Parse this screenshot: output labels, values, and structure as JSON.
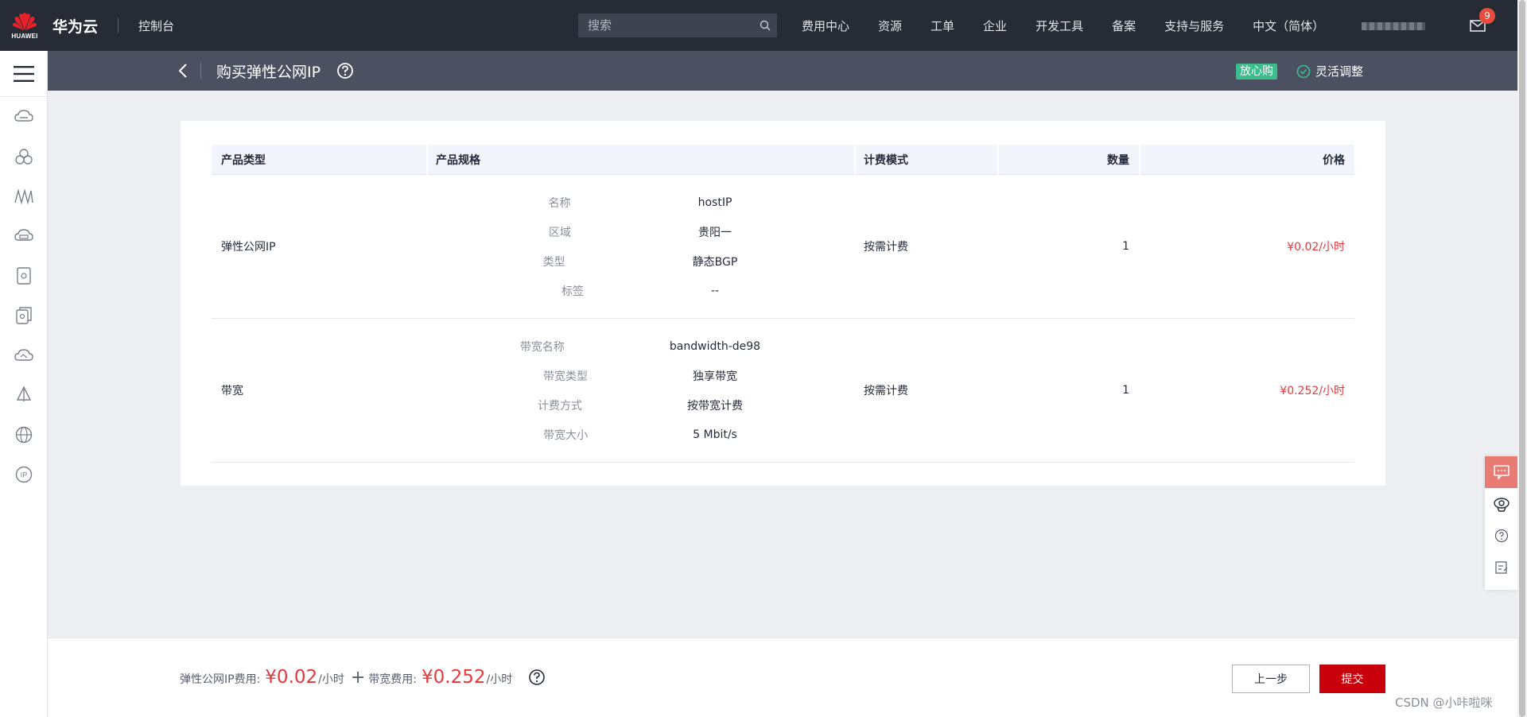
{
  "header": {
    "logo_text": "HUAWEI",
    "brand": "华为云",
    "console": "控制台",
    "search_placeholder": "搜索",
    "nav": [
      "费用中心",
      "资源",
      "工单",
      "企业",
      "开发工具",
      "备案",
      "支持与服务",
      "中文（简体）"
    ],
    "mail_badge": "9"
  },
  "rail": {
    "icons": [
      "cloud-server-icon",
      "cluster-icon",
      "network-icon",
      "storage-icon",
      "database-icon",
      "backup-icon",
      "cloud-icon",
      "cdn-icon",
      "globe-icon",
      "ip-icon"
    ]
  },
  "subheader": {
    "title": "购买弹性公网IP",
    "reassure_label": "放心购",
    "flex_label": "灵活调整"
  },
  "table": {
    "headers": [
      "产品类型",
      "产品规格",
      "计费模式",
      "数量",
      "价格"
    ],
    "rows": [
      {
        "type": "弹性公网IP",
        "specs": [
          {
            "k": "名称",
            "v": "hostIP"
          },
          {
            "k": "区域",
            "v": "贵阳一"
          },
          {
            "k": "类型",
            "v": "静态BGP"
          },
          {
            "k": "标签",
            "v": "--"
          }
        ],
        "billing": "按需计费",
        "qty": "1",
        "price": "¥0.02/小时"
      },
      {
        "type": "带宽",
        "specs": [
          {
            "k": "带宽名称",
            "v": "bandwidth-de98"
          },
          {
            "k": "带宽类型",
            "v": "独享带宽"
          },
          {
            "k": "计费方式",
            "v": "按带宽计费"
          },
          {
            "k": "带宽大小",
            "v": "5 Mbit/s"
          }
        ],
        "billing": "按需计费",
        "qty": "1",
        "price": "¥0.252/小时"
      }
    ]
  },
  "footer": {
    "eip_fee_label": "弹性公网IP费用:",
    "eip_fee": "¥0.02",
    "unit": "/小时",
    "plus": "+",
    "bw_fee_label": "带宽费用:",
    "bw_fee": "¥0.252",
    "prev_button": "上一步",
    "submit_button": "提交"
  },
  "watermark": "CSDN @小咔啦咪",
  "colors": {
    "accent": "#c7000b",
    "price": "#e4393c",
    "topbar": "#262b35",
    "subheader": "#4b5160",
    "reassure": "#3bbd8e"
  }
}
